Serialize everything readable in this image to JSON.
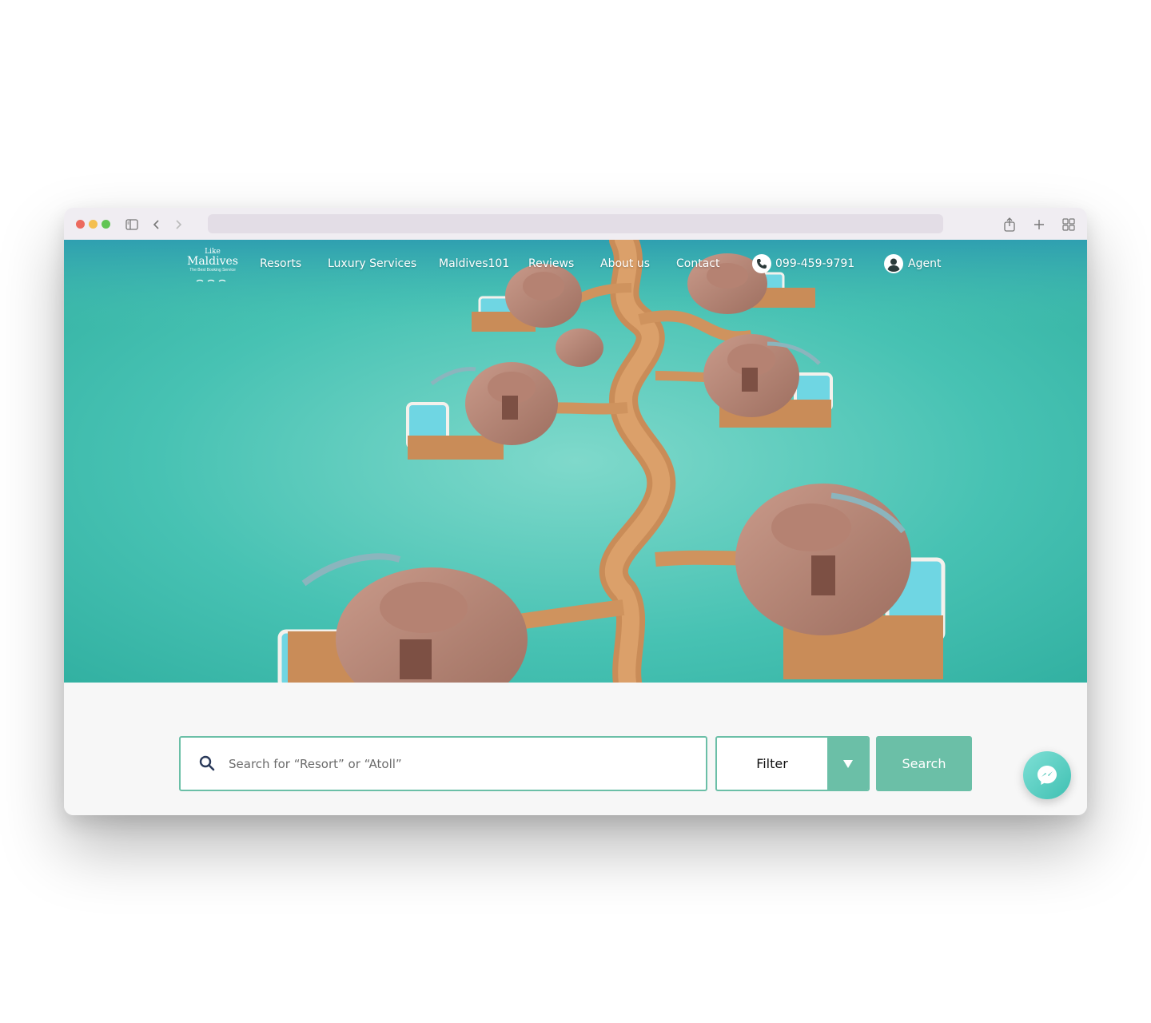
{
  "logo": {
    "line1": "Like",
    "line2": "Maldives",
    "tagline": "The Best Booking Service"
  },
  "nav": {
    "items": [
      "Resorts",
      "Luxury Services",
      "Maldives101",
      "Reviews",
      "About us",
      "Contact"
    ],
    "phone": "099-459-9791",
    "agent": "Agent"
  },
  "search": {
    "placeholder": "Search for “Resort” or “Atoll”",
    "filter_label": "Filter",
    "button_label": "Search"
  },
  "icons": {
    "browser": [
      "sidebar-icon",
      "back-icon",
      "forward-icon",
      "share-icon",
      "new-tab-icon",
      "tab-overview-icon"
    ],
    "search": "search-icon",
    "filter": "triangle-down-icon",
    "phone": "phone-icon",
    "agent": "user-icon",
    "chat": "messenger-icon"
  },
  "colors": {
    "accent": "#6bbfa7",
    "water": "#3fbfb0",
    "deck": "#c88a55",
    "roof": "#b07a6a"
  }
}
